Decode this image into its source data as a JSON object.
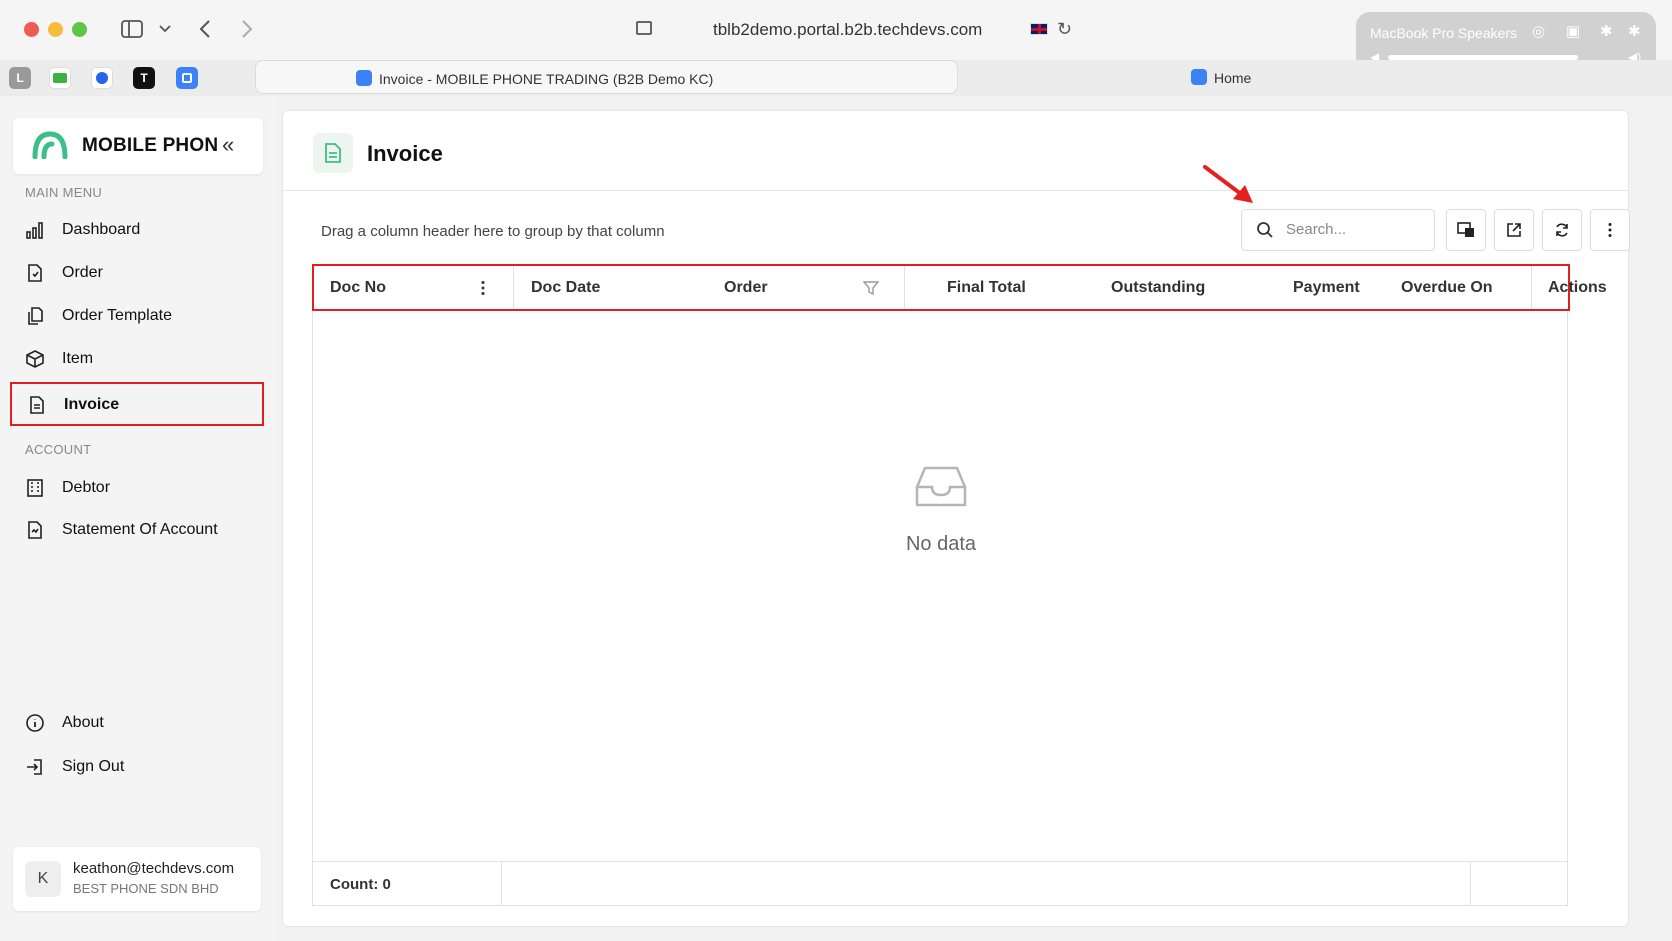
{
  "browser": {
    "url": "tblb2demo.portal.b2b.techdevs.com",
    "tabs": [
      {
        "label": "Invoice - MOBILE PHONE TRADING (B2B Demo KC)"
      },
      {
        "label": "Home"
      }
    ],
    "pinned": [
      "L",
      "T"
    ],
    "speaker_popup": {
      "title": "MacBook Pro Speakers",
      "volume": 0.85
    }
  },
  "sidebar": {
    "brand": "MOBILE PHON",
    "collapse_glyph": "«",
    "main_menu_label": "MAIN MENU",
    "main_menu": [
      {
        "label": "Dashboard",
        "icon": "bar-chart-icon"
      },
      {
        "label": "Order",
        "icon": "order-doc-icon"
      },
      {
        "label": "Order Template",
        "icon": "copy-doc-icon"
      },
      {
        "label": "Item",
        "icon": "cube-icon"
      },
      {
        "label": "Invoice",
        "icon": "invoice-doc-icon",
        "active": true
      }
    ],
    "account_label": "ACCOUNT",
    "account_menu": [
      {
        "label": "Debtor",
        "icon": "building-icon"
      },
      {
        "label": "Statement Of Account",
        "icon": "statement-doc-icon"
      }
    ],
    "bottom_menu": [
      {
        "label": "About",
        "icon": "info-icon"
      },
      {
        "label": "Sign Out",
        "icon": "sign-out-icon"
      }
    ],
    "user": {
      "initial": "K",
      "email": "keathon@techdevs.com",
      "company": "BEST PHONE SDN BHD"
    }
  },
  "main": {
    "title": "Invoice",
    "group_hint": "Drag a column header here to group by that column",
    "search_placeholder": "Search...",
    "columns": [
      "Doc No",
      "Doc Date",
      "Order",
      "Final Total",
      "Outstanding",
      "Payment",
      "Overdue On",
      "Actions"
    ],
    "rows": [],
    "empty_text": "No data",
    "count_label": "Count: 0"
  },
  "colors": {
    "accent": "#3dbf8a",
    "highlight": "#e02020"
  }
}
